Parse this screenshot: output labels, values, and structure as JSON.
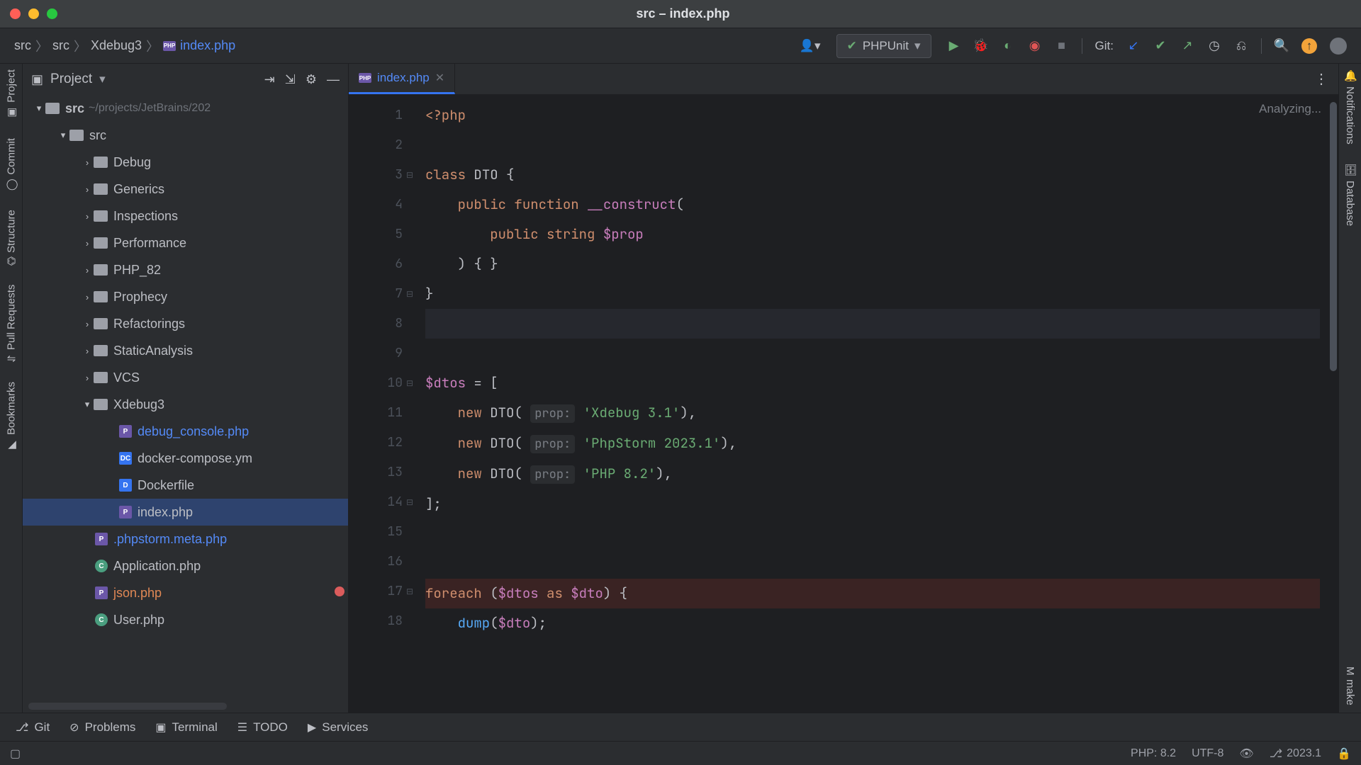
{
  "window": {
    "title": "src – index.php"
  },
  "breadcrumb": {
    "p1": "src",
    "p2": "src",
    "p3": "Xdebug3",
    "p4": "index.php"
  },
  "runconfig": {
    "label": "PHPUnit"
  },
  "git": {
    "label": "Git:"
  },
  "leftRail": {
    "project": "Project",
    "commit": "Commit",
    "structure": "Structure",
    "pullreq": "Pull Requests",
    "bookmarks": "Bookmarks"
  },
  "rightRail": {
    "notifications": "Notifications",
    "database": "Database",
    "make": "make"
  },
  "projectPanel": {
    "title": "Project",
    "root": {
      "name": "src",
      "path": "~/projects/JetBrains/202"
    },
    "src": "src",
    "folders": [
      "Debug",
      "Generics",
      "Inspections",
      "Performance",
      "PHP_82",
      "Prophecy",
      "Refactorings",
      "StaticAnalysis",
      "VCS"
    ],
    "xdebug": "Xdebug3",
    "xdebugFiles": {
      "debug_console": "debug_console.php",
      "docker_compose": "docker-compose.ym",
      "dockerfile": "Dockerfile",
      "index": "index.php"
    },
    "rootFiles": {
      "meta": ".phpstorm.meta.php",
      "application": "Application.php",
      "json": "json.php",
      "user": "User.php"
    }
  },
  "tabs": {
    "file": "index.php"
  },
  "editor": {
    "analyzing": "Analyzing...",
    "lines": [
      "1",
      "2",
      "3",
      "4",
      "5",
      "6",
      "7",
      "8",
      "9",
      "10",
      "11",
      "12",
      "13",
      "14",
      "15",
      "16",
      "17",
      "18"
    ],
    "code": {
      "l1_open": "<?php",
      "l3_class": "class",
      "l3_name": "DTO",
      "l3_brace": " {",
      "l4_pub": "public",
      "l4_fn": "function",
      "l4_con": "__construct",
      "l4_paren": "(",
      "l5_pub": "public",
      "l5_str": "string",
      "l5_var": "$prop",
      "l6": ") { }",
      "l7": "}",
      "l10_var": "$dtos",
      "l10_eq": " = [",
      "l11_new": "new",
      "l11_cls": "DTO",
      "l11_hint": "prop:",
      "l11_str": "'Xdebug 3.1'",
      "l11_end": "),",
      "l12_new": "new",
      "l12_cls": "DTO",
      "l12_hint": "prop:",
      "l12_str": "'PhpStorm 2023.1'",
      "l12_end": "),",
      "l13_new": "new",
      "l13_cls": "DTO",
      "l13_hint": "prop:",
      "l13_str": "'PHP 8.2'",
      "l13_end": "),",
      "l14": "];",
      "l17_for": "foreach",
      "l17_op": " (",
      "l17_v1": "$dtos",
      "l17_as": " as ",
      "l17_v2": "$dto",
      "l17_cl": ") {",
      "l18_fn": "dump",
      "l18_op": "(",
      "l18_v": "$dto",
      "l18_cl": ");"
    }
  },
  "bottomBar": {
    "git": "Git",
    "problems": "Problems",
    "terminal": "Terminal",
    "todo": "TODO",
    "services": "Services"
  },
  "statusBar": {
    "php": "PHP: 8.2",
    "enc": "UTF-8",
    "ver": "2023.1"
  }
}
